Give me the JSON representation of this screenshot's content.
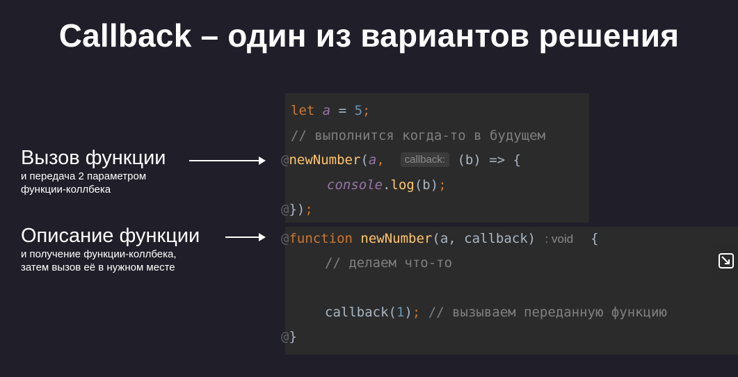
{
  "title": "Callback – один из вариантов решения",
  "labels": {
    "call": {
      "main": "Вызов функции",
      "sub1": "и передача 2 параметром",
      "sub2": "функции-коллбека"
    },
    "describe": {
      "main": "Описание функции",
      "sub1": "и получение функции-коллбека,",
      "sub2": "затем вызов её в нужном месте"
    }
  },
  "code_top": {
    "line1": {
      "kw": "let",
      "var": "a",
      "op": " = ",
      "num": "5",
      "end": ";"
    },
    "line2": "// выполнится когда-то в будущем",
    "line3": {
      "gutter": "@",
      "fn": "newNumber",
      "open": "(",
      "var": "a",
      "comma": ",",
      "hint": "callback:",
      "rest": "(b) => {"
    },
    "line4": {
      "obj": "console",
      "dot": ".",
      "fn": "log",
      "args": "(b)",
      "end": ";"
    },
    "line5": {
      "gutter": "@",
      "text": "})",
      "end": ";"
    }
  },
  "code_bottom": {
    "line1": {
      "gutter": "@",
      "kw": "function",
      "fn": "newNumber",
      "params": "(a, callback)",
      "hint": ": void",
      "brace": "{"
    },
    "line2": "// делаем что-то",
    "line3": {
      "call": "callback(",
      "num": "1",
      "close": ")",
      "end": ";",
      "comment": "// вызываем переданную функцию"
    },
    "line4": {
      "gutter": "@",
      "brace": "}"
    }
  },
  "side_icon": "exit-fullscreen-icon"
}
